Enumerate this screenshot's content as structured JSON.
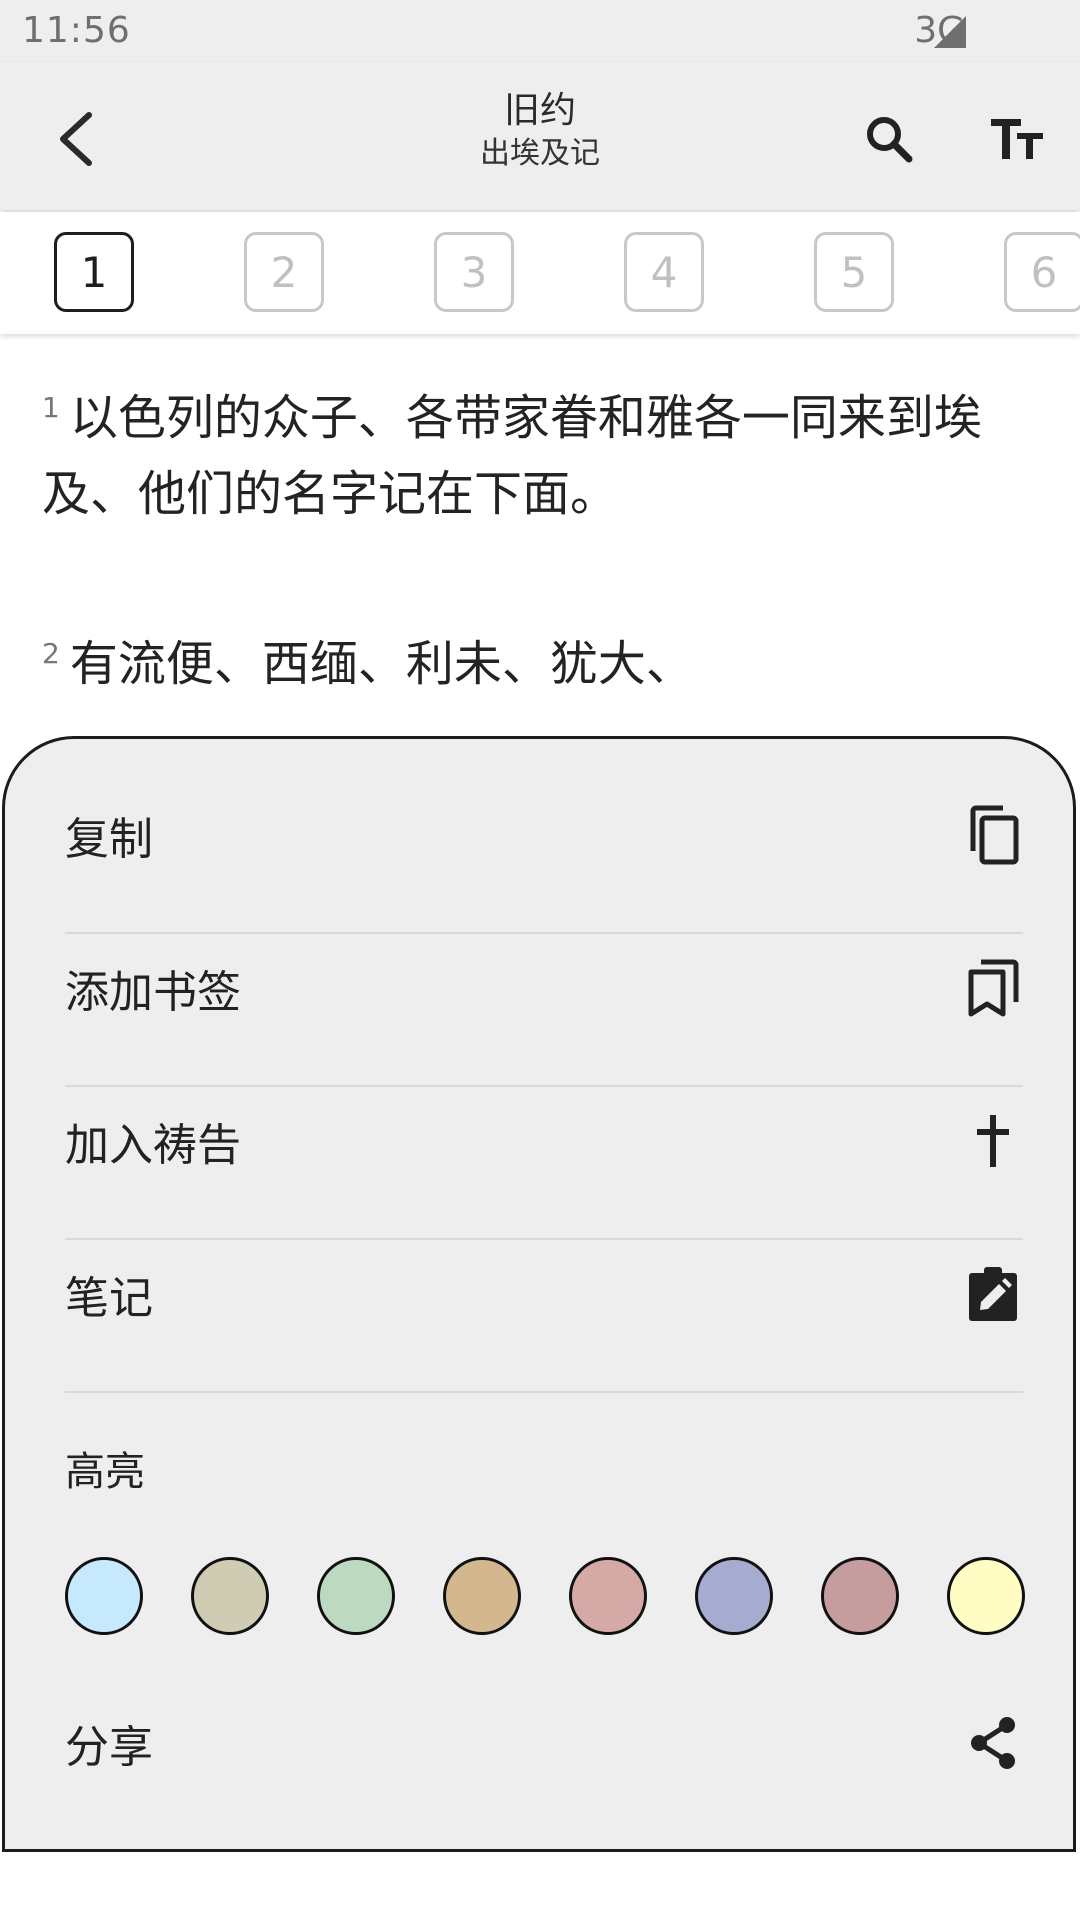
{
  "status": {
    "time": "11:56",
    "network": "3G"
  },
  "header": {
    "title": "旧约",
    "subtitle": "出埃及记"
  },
  "chapters": [
    "1",
    "2",
    "3",
    "4",
    "5",
    "6"
  ],
  "selected_chapter": "1",
  "verses": [
    {
      "num": "1",
      "text": "以色列的众子、各带家眷和雅各一同来到埃及、他们的名字记在下面。"
    },
    {
      "num": "2",
      "text": "有流便、西缅、利未、犹大、"
    }
  ],
  "sheet": {
    "copy_label": "复制",
    "bookmark_label": "添加书签",
    "prayer_label": "加入祷告",
    "note_label": "笔记",
    "highlight_label": "高亮",
    "share_label": "分享",
    "highlight_colors": [
      "#c7e9fd",
      "#cfccb3",
      "#bdd9bf",
      "#d3b88f",
      "#d5a9a6",
      "#a6acd0",
      "#c69d9f",
      "#fffdc4"
    ]
  }
}
